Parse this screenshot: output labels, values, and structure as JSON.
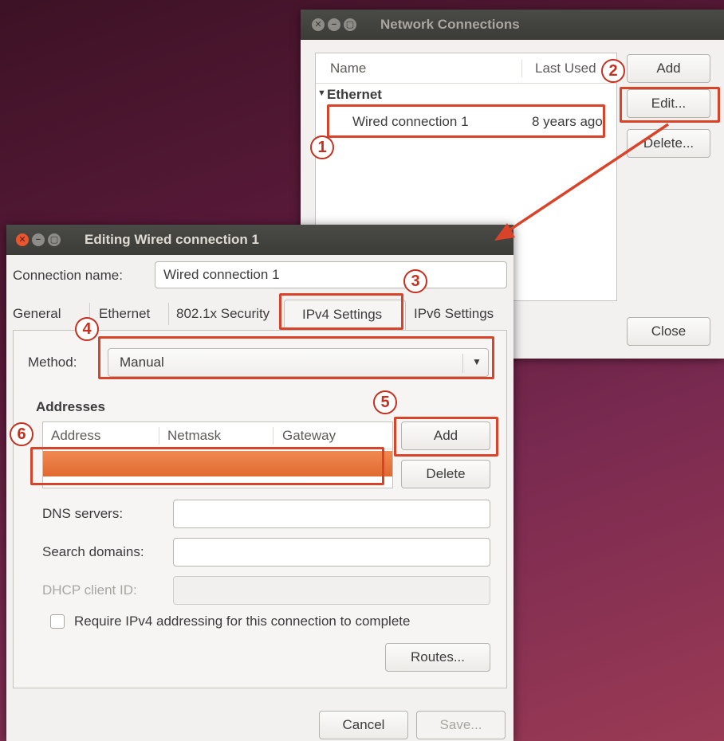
{
  "network_window": {
    "title": "Network Connections",
    "columns": [
      "Name",
      "Last Used"
    ],
    "group_label": "Ethernet",
    "row": {
      "name": "Wired connection 1",
      "last_used": "8 years ago"
    },
    "buttons": {
      "add": "Add",
      "edit": "Edit...",
      "delete": "Delete...",
      "close": "Close"
    }
  },
  "edit_window": {
    "title": "Editing Wired connection 1",
    "connection_name_label": "Connection name:",
    "connection_name_value": "Wired connection 1",
    "tabs": [
      "General",
      "Ethernet",
      "802.1x Security",
      "IPv4 Settings",
      "IPv6 Settings"
    ],
    "active_tab": "IPv4 Settings",
    "method_label": "Method:",
    "method_value": "Manual",
    "addresses_heading": "Addresses",
    "address_columns": [
      "Address",
      "Netmask",
      "Gateway"
    ],
    "add_button": "Add",
    "delete_button": "Delete",
    "dns_label": "DNS servers:",
    "dns_value": "",
    "search_label": "Search domains:",
    "search_value": "",
    "dhcp_label": "DHCP client ID:",
    "dhcp_value": "",
    "require_checkbox_label": "Require IPv4 addressing for this connection to complete",
    "require_checked": false,
    "routes_button": "Routes...",
    "cancel_button": "Cancel",
    "save_button": "Save..."
  },
  "annotations": [
    "1",
    "2",
    "3",
    "4",
    "5",
    "6"
  ],
  "colors": {
    "highlight_red": "#d9432a",
    "selection_orange": "#e8703a",
    "titlebar": "#3c3b37",
    "close_button": "#e9562e"
  }
}
